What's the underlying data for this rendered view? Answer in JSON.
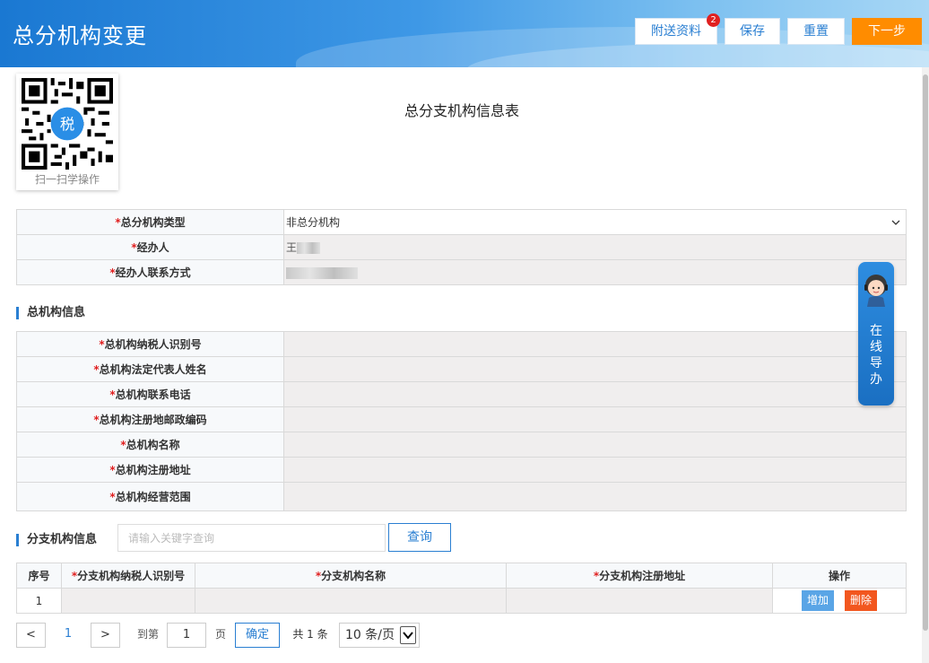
{
  "header": {
    "title": "总分机构变更",
    "buttons": {
      "attach": "附送资料",
      "attach_badge": "2",
      "save": "保存",
      "reset": "重置",
      "next": "下一步"
    }
  },
  "qr": {
    "label": "扫一扫学操作",
    "logo_icon": "tax-logo-icon"
  },
  "form_title": "总分支机构信息表",
  "basic": {
    "rows": [
      {
        "label": "总分机构类型",
        "value": "非总分机构",
        "type": "select"
      },
      {
        "label": "经办人",
        "value": "王",
        "type": "text"
      },
      {
        "label": "经办人联系方式",
        "value": "",
        "type": "text"
      }
    ]
  },
  "hq": {
    "section_title": "总机构信息",
    "rows": [
      {
        "label": "总机构纳税人识别号",
        "value": ""
      },
      {
        "label": "总机构法定代表人姓名",
        "value": ""
      },
      {
        "label": "总机构联系电话",
        "value": ""
      },
      {
        "label": "总机构注册地邮政编码",
        "value": ""
      },
      {
        "label": "总机构名称",
        "value": ""
      },
      {
        "label": "总机构注册地址",
        "value": ""
      },
      {
        "label": "总机构经营范围",
        "value": ""
      }
    ]
  },
  "branch": {
    "section_title": "分支机构信息",
    "search_placeholder": "请输入关键字查询",
    "search_button": "查询",
    "columns": [
      "序号",
      "分支机构纳税人识别号",
      "分支机构名称",
      "分支机构注册地址",
      "操作"
    ],
    "rows": [
      {
        "index": "1",
        "tax_id": "",
        "name": "",
        "address": ""
      }
    ],
    "add_label": "增加",
    "delete_label": "删除"
  },
  "pagination": {
    "prev": "<",
    "current": "1",
    "next": ">",
    "goto_prefix": "到第",
    "goto_value": "1",
    "goto_suffix": "页",
    "confirm": "确定",
    "total": "共 1 条",
    "page_size": "10 条/页"
  },
  "helper": {
    "label": "在线导办"
  },
  "colors": {
    "header_blue": "#1a78d2",
    "accent_blue": "#2a7fd2",
    "next_orange": "#ff8c00",
    "required_red": "#e02020",
    "delete_orange": "#f2571f"
  }
}
